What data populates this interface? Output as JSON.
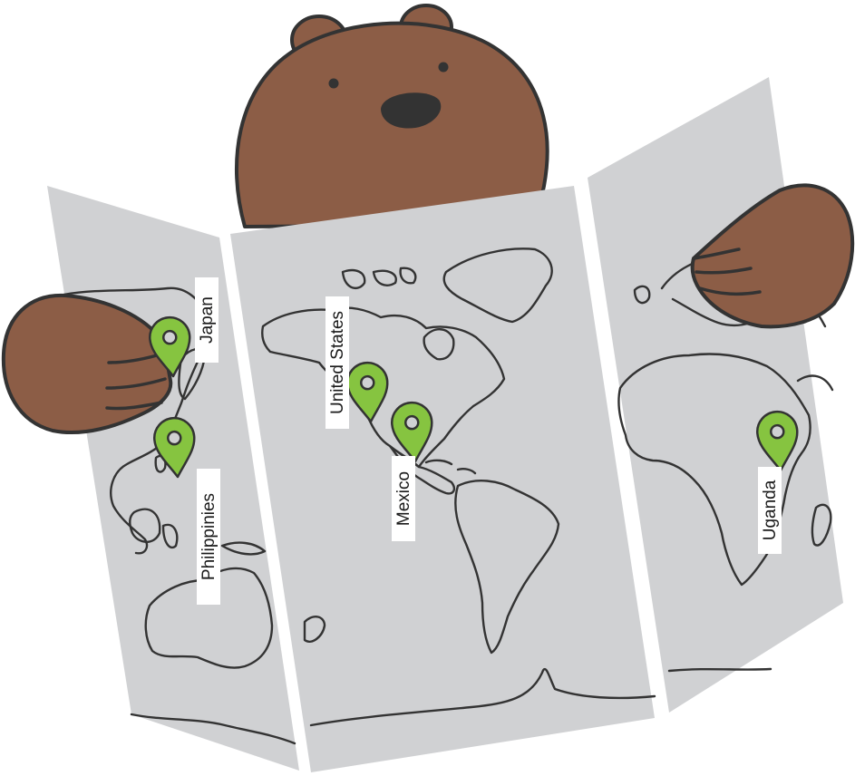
{
  "illustration": {
    "colors": {
      "fur": "#8c5d46",
      "outline": "#333333",
      "map_panel": "#d0d1d3",
      "pin": "#86c440",
      "label_background": "#ffffff"
    },
    "pins": [
      {
        "label": "Japan",
        "icon": "map-pin-icon"
      },
      {
        "label": "Philippinies",
        "icon": "map-pin-icon"
      },
      {
        "label": "United States",
        "icon": "map-pin-icon"
      },
      {
        "label": "Mexico",
        "icon": "map-pin-icon"
      },
      {
        "label": "Uganda",
        "icon": "map-pin-icon"
      }
    ]
  }
}
